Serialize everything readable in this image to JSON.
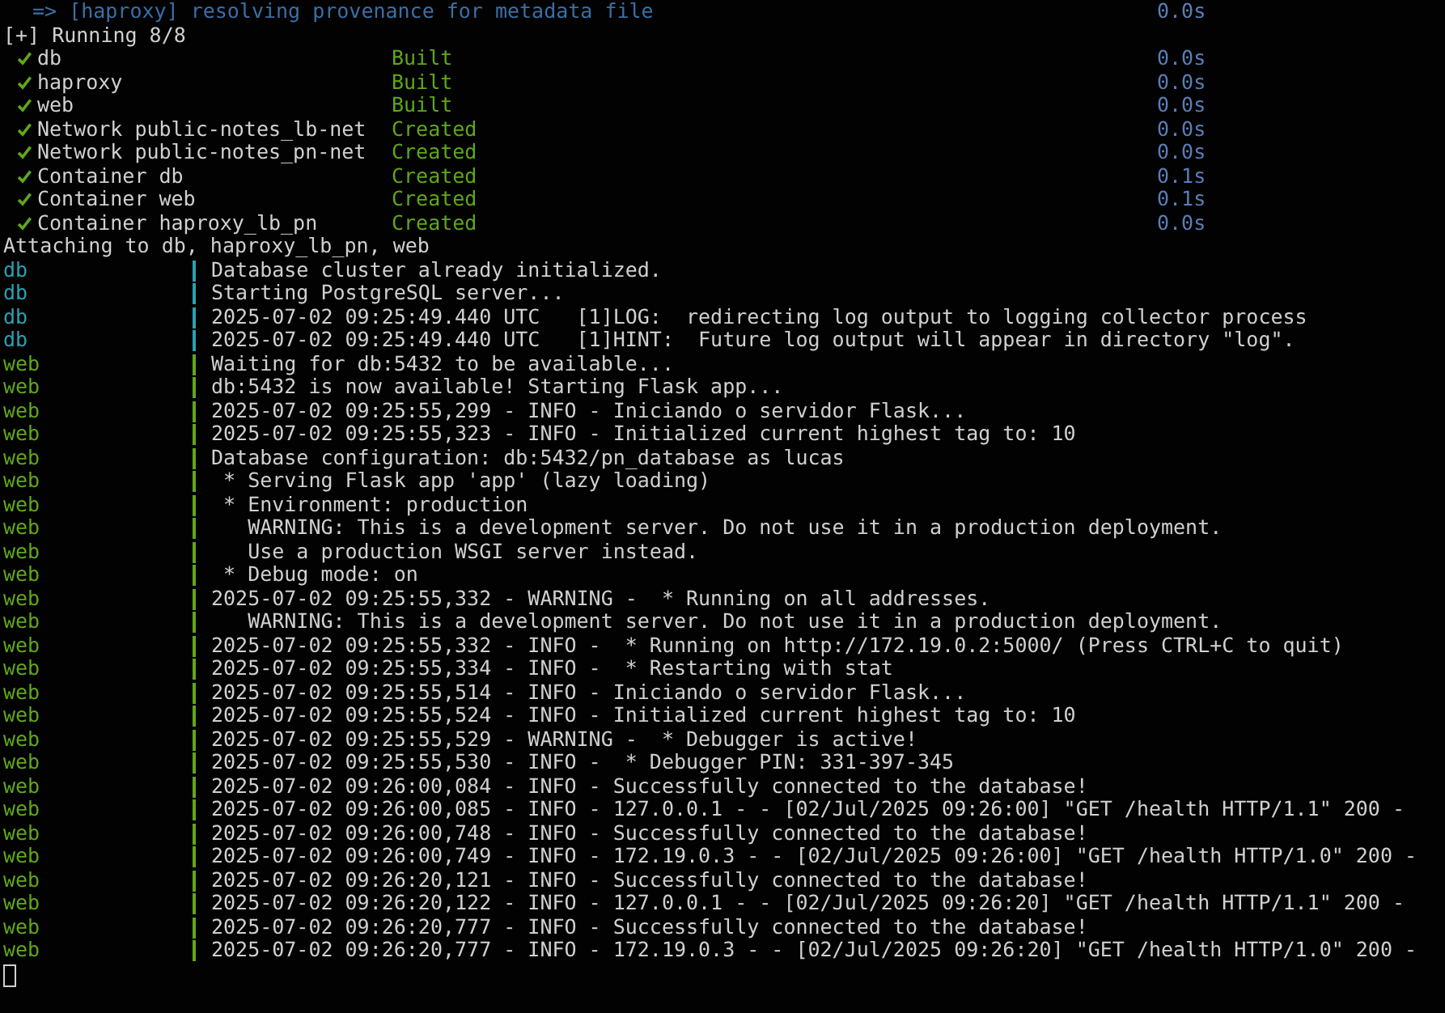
{
  "header_line": {
    "text": "=> [haproxy] resolving provenance for metadata file",
    "time": "0.0s"
  },
  "progress": {
    "title": "[+] Running 8/8",
    "items": [
      {
        "name": "db",
        "status": "Built",
        "time": "0.0s",
        "done": true
      },
      {
        "name": "haproxy",
        "status": "Built",
        "time": "0.0s",
        "done": true
      },
      {
        "name": "web",
        "status": "Built",
        "time": "0.0s",
        "done": true
      },
      {
        "name": "Network public-notes_lb-net",
        "status": "Created",
        "time": "0.0s",
        "done": true
      },
      {
        "name": "Network public-notes_pn-net",
        "status": "Created",
        "time": "0.0s",
        "done": true
      },
      {
        "name": "Container db",
        "status": "Created",
        "time": "0.1s",
        "done": true
      },
      {
        "name": "Container web",
        "status": "Created",
        "time": "0.1s",
        "done": true
      },
      {
        "name": "Container haproxy_lb_pn",
        "status": "Created",
        "time": "0.0s",
        "done": true
      }
    ]
  },
  "attach_line": "Attaching to db, haproxy_lb_pn, web",
  "log_lines": [
    {
      "service": "db",
      "color": "#2aa1b3",
      "message": "Database cluster already initialized."
    },
    {
      "service": "db",
      "color": "#2aa1b3",
      "message": "Starting PostgreSQL server..."
    },
    {
      "service": "db",
      "color": "#2aa1b3",
      "message": "2025-07-02 09:25:49.440 UTC   [1]LOG:  redirecting log output to logging collector process"
    },
    {
      "service": "db",
      "color": "#2aa1b3",
      "message": "2025-07-02 09:25:49.440 UTC   [1]HINT:  Future log output will appear in directory \"log\"."
    },
    {
      "service": "web",
      "color": "#5fa818",
      "message": "Waiting for db:5432 to be available..."
    },
    {
      "service": "web",
      "color": "#5fa818",
      "message": "db:5432 is now available! Starting Flask app..."
    },
    {
      "service": "web",
      "color": "#5fa818",
      "message": "2025-07-02 09:25:55,299 - INFO - Iniciando o servidor Flask..."
    },
    {
      "service": "web",
      "color": "#5fa818",
      "message": "2025-07-02 09:25:55,323 - INFO - Initialized current highest tag to: 10"
    },
    {
      "service": "web",
      "color": "#5fa818",
      "message": "Database configuration: db:5432/pn_database as lucas"
    },
    {
      "service": "web",
      "color": "#5fa818",
      "message": " * Serving Flask app 'app' (lazy loading)"
    },
    {
      "service": "web",
      "color": "#5fa818",
      "message": " * Environment: production"
    },
    {
      "service": "web",
      "color": "#5fa818",
      "message": "   WARNING: This is a development server. Do not use it in a production deployment."
    },
    {
      "service": "web",
      "color": "#5fa818",
      "message": "   Use a production WSGI server instead."
    },
    {
      "service": "web",
      "color": "#5fa818",
      "message": " * Debug mode: on"
    },
    {
      "service": "web",
      "color": "#5fa818",
      "message": "2025-07-02 09:25:55,332 - WARNING -  * Running on all addresses."
    },
    {
      "service": "web",
      "color": "#5fa818",
      "message": "   WARNING: This is a development server. Do not use it in a production deployment."
    },
    {
      "service": "web",
      "color": "#5fa818",
      "message": "2025-07-02 09:25:55,332 - INFO -  * Running on http://172.19.0.2:5000/ (Press CTRL+C to quit)"
    },
    {
      "service": "web",
      "color": "#5fa818",
      "message": "2025-07-02 09:25:55,334 - INFO -  * Restarting with stat"
    },
    {
      "service": "web",
      "color": "#5fa818",
      "message": "2025-07-02 09:25:55,514 - INFO - Iniciando o servidor Flask..."
    },
    {
      "service": "web",
      "color": "#5fa818",
      "message": "2025-07-02 09:25:55,524 - INFO - Initialized current highest tag to: 10"
    },
    {
      "service": "web",
      "color": "#5fa818",
      "message": "2025-07-02 09:25:55,529 - WARNING -  * Debugger is active!"
    },
    {
      "service": "web",
      "color": "#5fa818",
      "message": "2025-07-02 09:25:55,530 - INFO -  * Debugger PIN: 331-397-345"
    },
    {
      "service": "web",
      "color": "#5fa818",
      "message": "2025-07-02 09:26:00,084 - INFO - Successfully connected to the database!"
    },
    {
      "service": "web",
      "color": "#5fa818",
      "message": "2025-07-02 09:26:00,085 - INFO - 127.0.0.1 - - [02/Jul/2025 09:26:00] \"GET /health HTTP/1.1\" 200 -"
    },
    {
      "service": "web",
      "color": "#5fa818",
      "message": "2025-07-02 09:26:00,748 - INFO - Successfully connected to the database!"
    },
    {
      "service": "web",
      "color": "#5fa818",
      "message": "2025-07-02 09:26:00,749 - INFO - 172.19.0.3 - - [02/Jul/2025 09:26:00] \"GET /health HTTP/1.0\" 200 -"
    },
    {
      "service": "web",
      "color": "#5fa818",
      "message": "2025-07-02 09:26:20,121 - INFO - Successfully connected to the database!"
    },
    {
      "service": "web",
      "color": "#5fa818",
      "message": "2025-07-02 09:26:20,122 - INFO - 127.0.0.1 - - [02/Jul/2025 09:26:20] \"GET /health HTTP/1.1\" 200 -"
    },
    {
      "service": "web",
      "color": "#5fa818",
      "message": "2025-07-02 09:26:20,777 - INFO - Successfully connected to the database!"
    },
    {
      "service": "web",
      "color": "#5fa818",
      "message": "2025-07-02 09:26:20,777 - INFO - 172.19.0.3 - - [02/Jul/2025 09:26:20] \"GET /health HTTP/1.0\" 200 -"
    }
  ]
}
